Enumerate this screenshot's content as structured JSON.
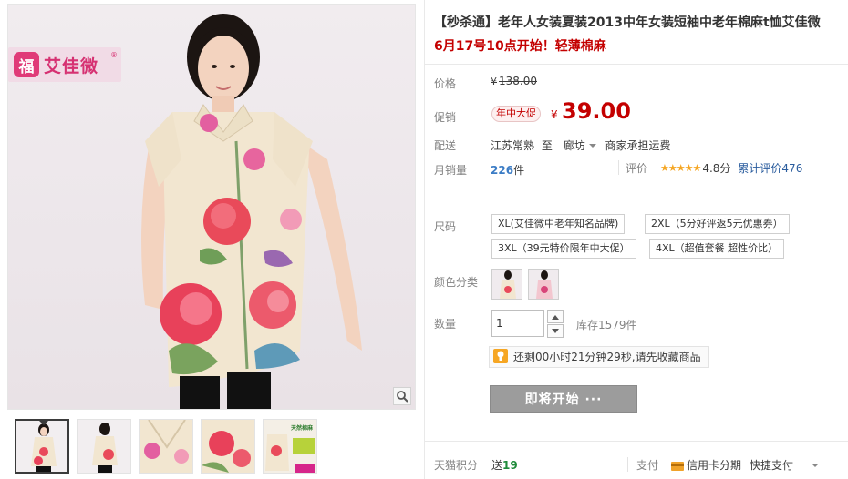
{
  "gallery": {
    "brand": {
      "seal_char": "福",
      "name": "艾佳微",
      "reg_mark": "®"
    },
    "zoom_icon": "magnifier-icon",
    "thumbnails": [
      {
        "name": "thumb-front-view",
        "active": true
      },
      {
        "name": "thumb-back-view",
        "active": false
      },
      {
        "name": "thumb-collar-detail",
        "active": false
      },
      {
        "name": "thumb-pattern-detail",
        "active": false
      },
      {
        "name": "thumb-promo-banner",
        "active": false,
        "banner_text": "天然棉麻"
      }
    ]
  },
  "product": {
    "title": "【秒杀通】老年人女装夏装2013中年女装短袖中老年棉麻t恤艾佳微",
    "subtitle": "6月17号10点开始！轻薄棉麻"
  },
  "price": {
    "label": "价格",
    "currency": "¥",
    "original": "138.00"
  },
  "promo": {
    "label": "促销",
    "badge": "年中大促",
    "currency": "¥",
    "price": "39.00"
  },
  "delivery": {
    "label": "配送",
    "from": "江苏常熟",
    "to_word": "至",
    "to": "廊坊",
    "shipping": "商家承担运费"
  },
  "sales": {
    "label": "月销量",
    "count": "226",
    "unit": "件",
    "rating_label": "评价",
    "stars": "★★★★★",
    "score": "4.8分",
    "reviews_link": "累计评价476",
    "rating_value": 4.8
  },
  "options": {
    "size_label": "尺码",
    "sizes": [
      "XL(艾佳微中老年知名品牌)",
      "2XL（5分好评返5元优惠券）",
      "3XL（39元特价限年中大促）",
      "4XL（超值套餐 超性价比）"
    ],
    "color_label": "颜色分类",
    "colors": [
      "color-option-cream-floral",
      "color-option-pink-floral"
    ]
  },
  "quantity": {
    "label": "数量",
    "value": "1",
    "stock": "库存1579件"
  },
  "tip": {
    "text": "还剩00小时21分钟29秒,请先收藏商品",
    "icon": "lightbulb-icon"
  },
  "buy_button": {
    "label": "即将开始 ···"
  },
  "footer": {
    "points_label": "天猫积分",
    "points_prefix": "送",
    "points_value": "19",
    "pay_label": "支付",
    "credit": "信用卡分期",
    "quick_pay": "快捷支付"
  },
  "colors": {
    "accent_red": "#c40000",
    "link_blue": "#2b5d9e",
    "star_orange": "#f5a623",
    "button_gray": "#9c9c9c",
    "brand_pink": "#d63172"
  }
}
